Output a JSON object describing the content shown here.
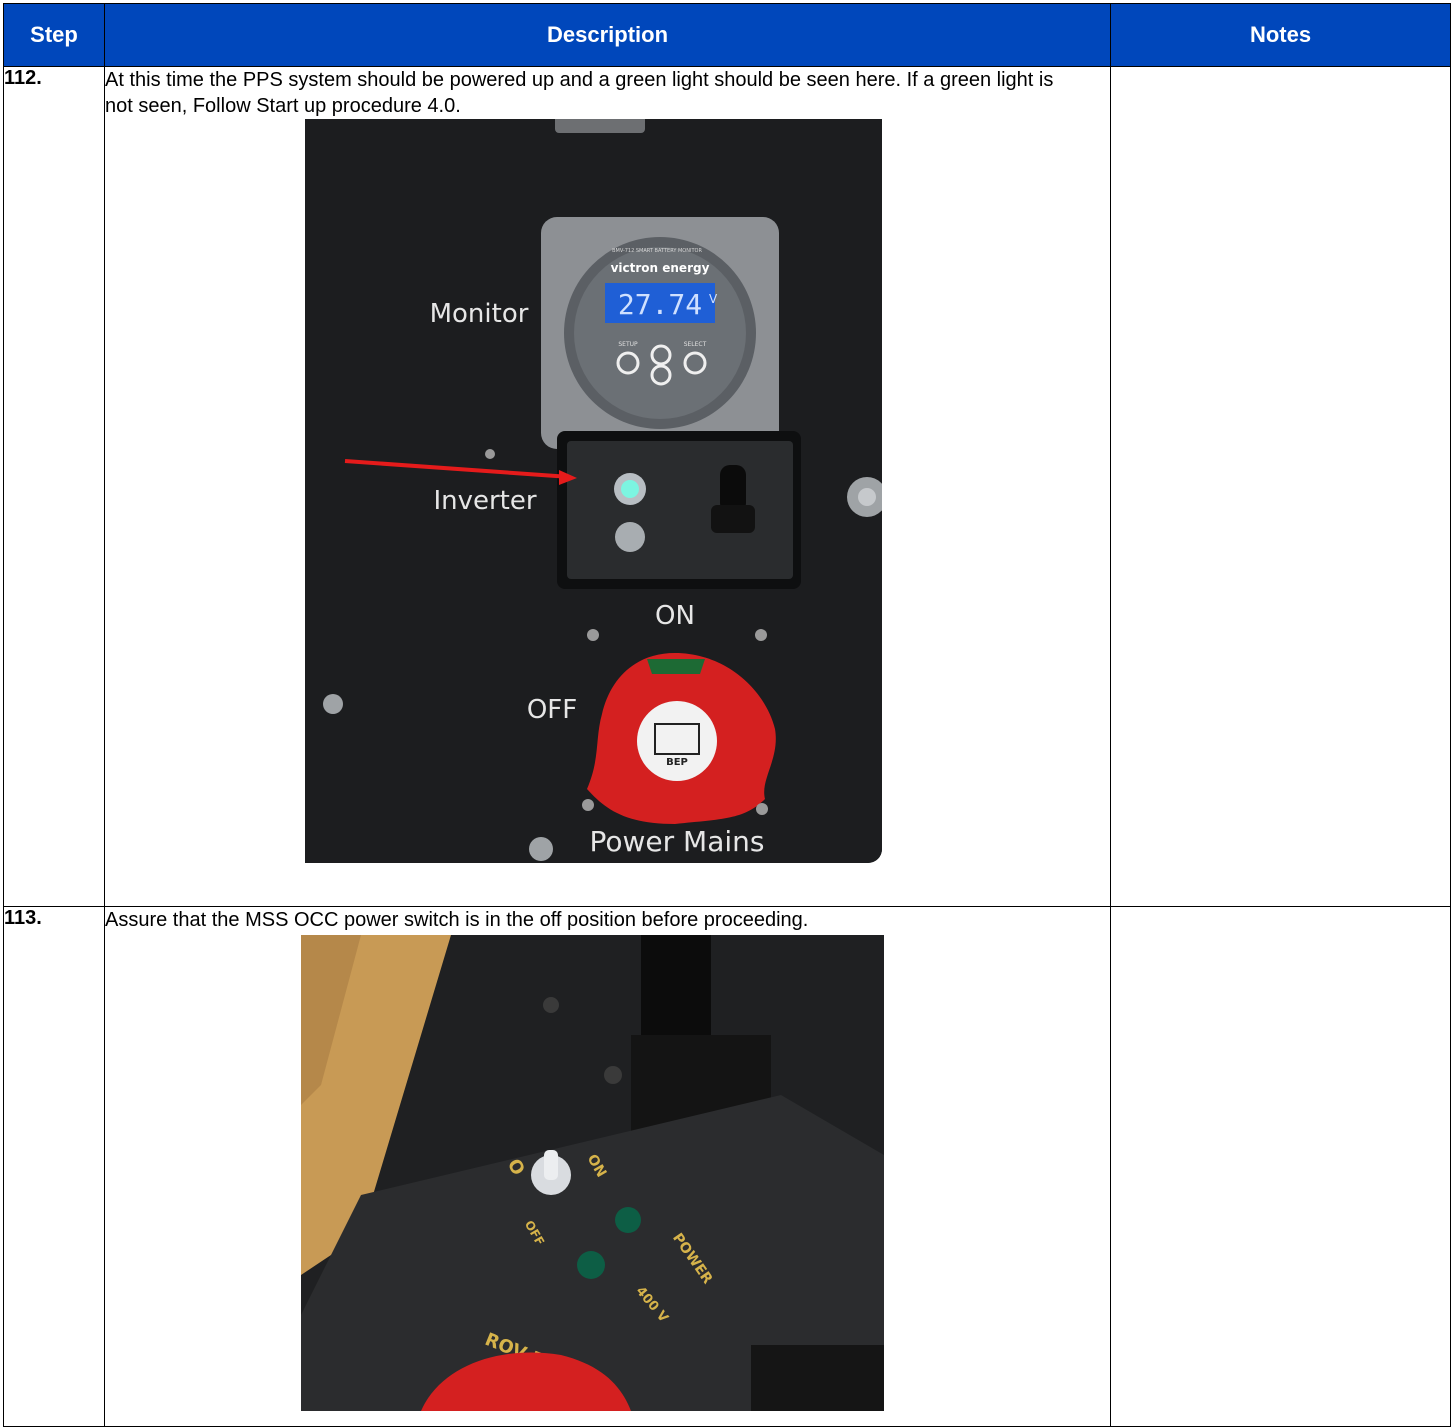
{
  "table": {
    "headers": {
      "step": "Step",
      "description": "Description",
      "notes": "Notes"
    },
    "rows": [
      {
        "step": "112.",
        "description": "At this time the PPS system should be powered up and a green light should be seen here. If a green light is not seen, Follow Start up procedure 4.0.",
        "notes": "",
        "photo": {
          "labels": {
            "monitor": "Monitor",
            "inverter": "Inverter",
            "on": "ON",
            "off": "OFF",
            "power_mains": "Power Mains",
            "brand": "victron energy",
            "model": "BMV-712 SMART BATTERY MONITOR",
            "display_value": "27.74",
            "display_unit": "V",
            "setup": "SETUP",
            "select": "SELECT",
            "bep": "BEP"
          }
        }
      },
      {
        "step": "113.",
        "description": "Assure that the MSS OCC power switch is in the off position before proceeding.",
        "notes": "",
        "photo": {
          "labels": {
            "on": "ON",
            "off": "OFF",
            "power": "POWER",
            "voltage": "400 V",
            "rov_power": "ROV POWER"
          }
        }
      }
    ]
  },
  "colors": {
    "header_bg": "#0047bb",
    "header_text": "#ffffff",
    "arrow": "#e51b1b",
    "knob": "#d42020"
  }
}
